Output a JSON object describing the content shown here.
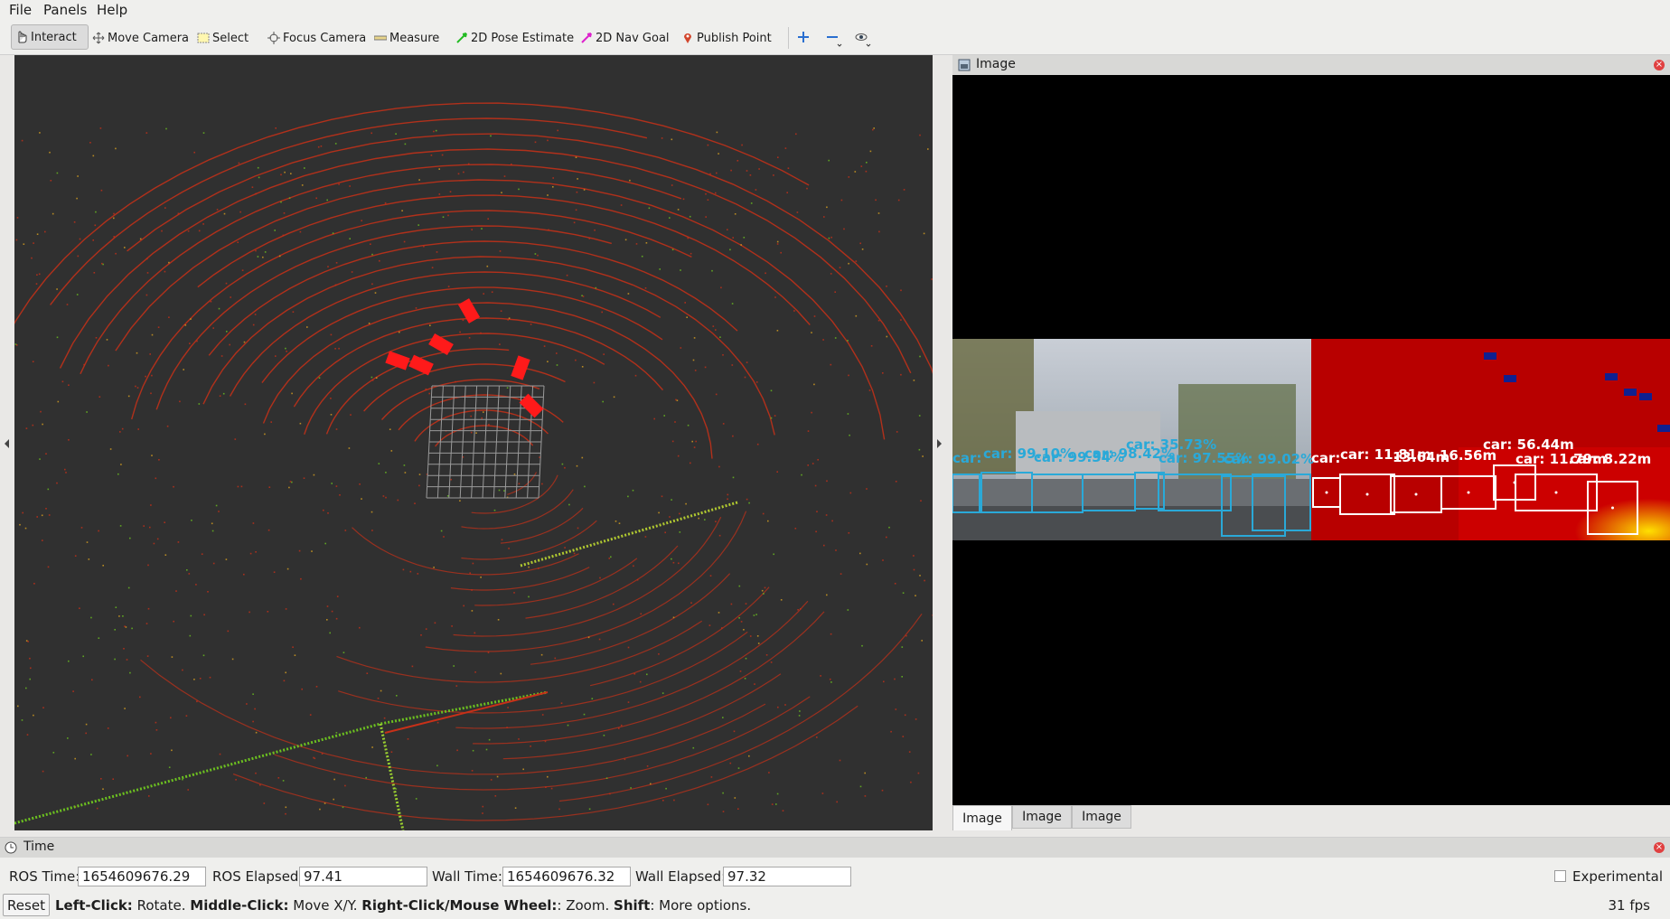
{
  "menu": {
    "file": "File",
    "panels": "Panels",
    "help": "Help"
  },
  "toolbar": {
    "interact": "Interact",
    "move_camera": "Move Camera",
    "select": "Select",
    "focus_camera": "Focus Camera",
    "measure": "Measure",
    "pose_estimate": "2D Pose Estimate",
    "nav_goal": "2D Nav Goal",
    "publish_point": "Publish Point"
  },
  "image_panel": {
    "title": "Image",
    "tabs": [
      "Image",
      "Image",
      "Image"
    ],
    "detections_left": [
      "car:",
      "car: 99.10%",
      "car: 99.34%",
      "car: 98.42%",
      "car: 35.73%",
      "car: 97.55%",
      "car: 99.02%"
    ],
    "detections_right": [
      "car:",
      "car: 11.81m",
      "13.64m",
      "16.56m",
      "car: 56.44m",
      "car: 11.79m",
      "car: 8.22m"
    ]
  },
  "time_panel": {
    "title": "Time",
    "ros_time_label": "ROS Time:",
    "ros_time_value": "1654609676.29",
    "ros_elapsed_label": "ROS Elapsed:",
    "ros_elapsed_value": "97.41",
    "wall_time_label": "Wall Time:",
    "wall_time_value": "1654609676.32",
    "wall_elapsed_label": "Wall Elapsed:",
    "wall_elapsed_value": "97.32",
    "experimental_label": "Experimental"
  },
  "status": {
    "reset": "Reset",
    "left_click": "Left-Click:",
    "left_click_desc": "Rotate.",
    "middle_click": "Middle-Click:",
    "middle_click_desc": "Move X/Y.",
    "right_click": "Right-Click/Mouse Wheel:",
    "right_click_desc": ": Zoom.",
    "shift": "Shift",
    "shift_desc": ": More options.",
    "fps": "31 fps"
  },
  "colors": {
    "accent_red": "#ff1a1a",
    "box_blue": "#2aa9d8",
    "lidar_red": "#c83018",
    "lidar_green": "#6cc020"
  }
}
